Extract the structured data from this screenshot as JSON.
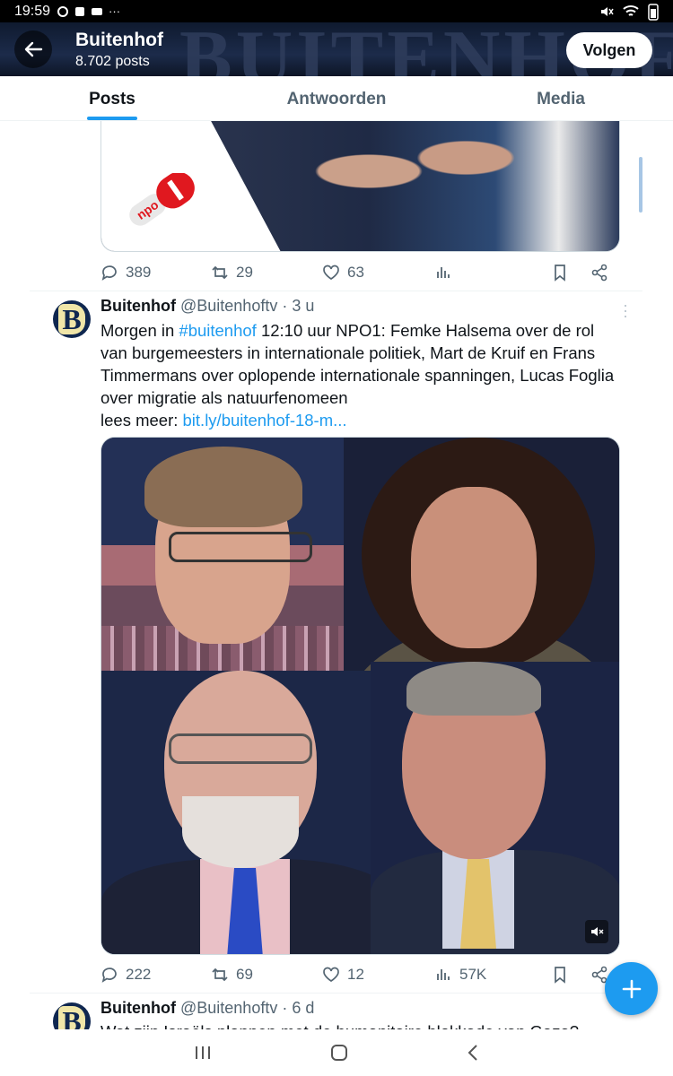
{
  "status_bar": {
    "time": "19:59",
    "dots": "···"
  },
  "header": {
    "banner_text": "BUITENHOF",
    "title": "Buitenhof",
    "post_count": "8.702 posts",
    "follow_label": "Volgen"
  },
  "tabs": [
    {
      "label": "Posts",
      "active": true
    },
    {
      "label": "Antwoorden",
      "active": false
    },
    {
      "label": "Media",
      "active": false
    }
  ],
  "posts": [
    {
      "media_logo_text": "npo",
      "replies": "389",
      "reposts": "29",
      "likes": "63",
      "views": ""
    },
    {
      "name": "Buitenhof",
      "handle": "@Buitenhoftv",
      "time": "· 3 u",
      "text_before_tag": "Morgen in ",
      "hashtag": "#buitenhof",
      "text_after_tag": " 12:10 uur NPO1: Femke Halsema over de rol van burgemeesters in internationale politiek, Mart de Kruif en Frans Timmermans over oplopende internationale spanningen, Lucas Foglia over migratie als natuurfenomeen",
      "link_prefix": "lees meer: ",
      "link": "bit.ly/buitenhof-18-m...",
      "replies": "222",
      "reposts": "69",
      "likes": "12",
      "views": "57K"
    },
    {
      "name": "Buitenhof",
      "handle": "@Buitenhoftv",
      "time": "· 6 d",
      "text": "Wat zijn Israëls plannen met de humanitaire blokkade van Gaza?"
    }
  ],
  "colors": {
    "accent": "#1d9bf0",
    "text": "#0f1419",
    "muted": "#536471"
  },
  "icons": [
    "back-arrow-icon",
    "reply-icon",
    "repost-icon",
    "like-icon",
    "views-icon",
    "bookmark-icon",
    "share-icon",
    "mute-icon",
    "compose-icon"
  ]
}
